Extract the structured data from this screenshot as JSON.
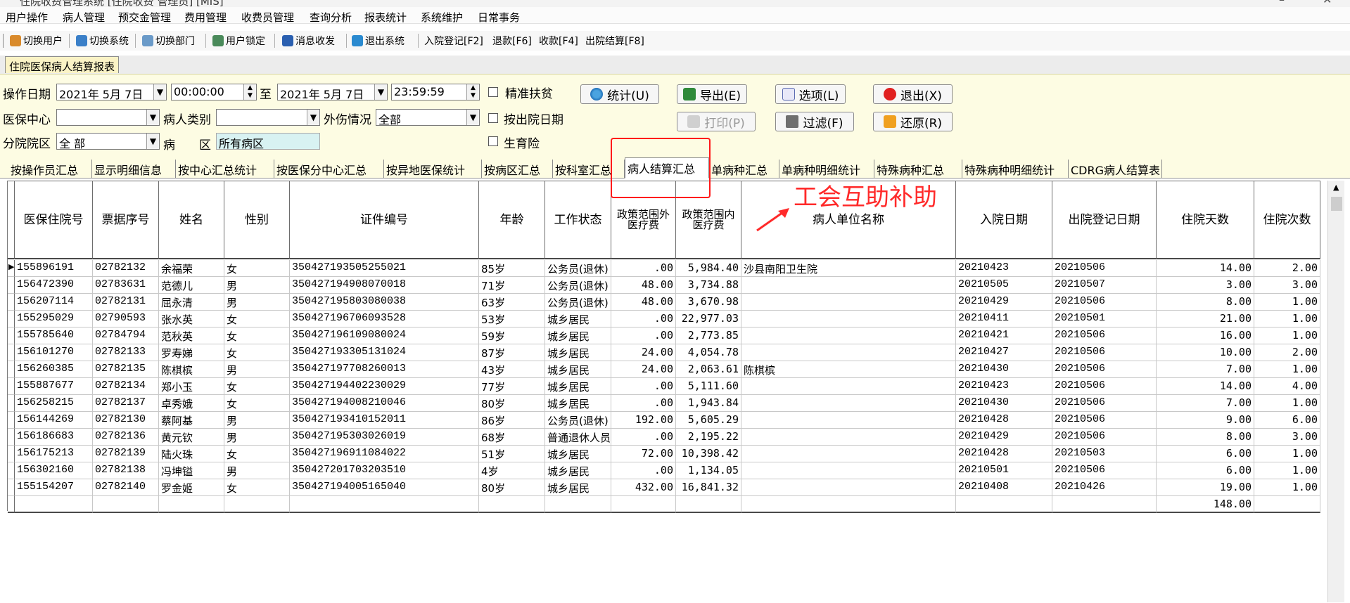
{
  "window": {
    "title": "住院收费管理系统 [住院收费 管理员]  [MIS]"
  },
  "menu": [
    "用户操作",
    "病人管理",
    "预交金管理",
    "费用管理",
    "收费员管理",
    "查询分析",
    "报表统计",
    "系统维护",
    "日常事务"
  ],
  "toolbar": {
    "items": [
      {
        "label": "切换用户",
        "icon": "users-icon"
      },
      {
        "label": "切换系统",
        "icon": "switch-system-icon"
      },
      {
        "label": "切换部门",
        "icon": "department-icon"
      },
      {
        "label": "用户锁定",
        "icon": "user-lock-icon"
      },
      {
        "label": "消息收发",
        "icon": "message-icon"
      },
      {
        "label": "退出系统",
        "icon": "exit-system-icon"
      },
      {
        "label": "入院登记[F2]"
      },
      {
        "label": "退款[F6]"
      },
      {
        "label": "收款[F4]"
      },
      {
        "label": "出院结算[F8]"
      }
    ]
  },
  "doc_tab": "住院医保病人结算报表",
  "filter": {
    "op_date_label": "操作日期",
    "date_from": "2021年 5月 7日",
    "time_from": "00:00:00",
    "to_label": "至",
    "date_to": "2021年 5月 7日",
    "time_to": "23:59:59",
    "center_label": "医保中心",
    "center_value": "",
    "patient_type_label": "病人类别",
    "patient_type_value": "",
    "injury_label": "外伤情况",
    "injury_value": "全部",
    "branch_label": "分院院区",
    "branch_value": "全 部",
    "ward_label": "病　　区",
    "ward_value": "所有病区",
    "checkbox_poverty": "精准扶贫",
    "checkbox_discharge_date": "按出院日期",
    "checkbox_maternity": "生育险",
    "btn_stats": "统计(U)",
    "btn_export": "导出(E)",
    "btn_options": "选项(L)",
    "btn_exit": "退出(X)",
    "btn_print": "打印(P)",
    "btn_filter": "过滤(F)",
    "btn_restore": "还原(R)"
  },
  "sub_tabs": [
    "按操作员汇总",
    "显示明细信息",
    "按中心汇总统计",
    "按医保分中心汇总",
    "按异地医保统计",
    "按病区汇总",
    "按科室汇总",
    "病人结算汇总",
    "单病种汇总",
    "单病种明细统计",
    "特殊病种汇总",
    "特殊病种明细统计",
    "CDRG病人结算表"
  ],
  "active_sub_tab": "病人结算汇总",
  "grid": {
    "headers": [
      "医保住院号",
      "票据序号",
      "姓名",
      "性别",
      "证件编号",
      "年龄",
      "工作状态",
      "政策范围外医疗费",
      "政策范围内医疗费",
      "病人单位名称",
      "入院日期",
      "出院登记日期",
      "住院天数",
      "住院次数"
    ],
    "rows": [
      [
        "155896191",
        "02782132",
        "余福荣",
        "女",
        "350427193505255021",
        "85岁",
        "公务员(退休)",
        ".00",
        "5,984.40",
        "沙县南阳卫生院",
        "20210423",
        "20210506",
        "14.00",
        "2.00"
      ],
      [
        "156472390",
        "02783631",
        "范德儿",
        "男",
        "350427194908070018",
        "71岁",
        "公务员(退休)",
        "48.00",
        "3,734.88",
        "",
        "20210505",
        "20210507",
        "3.00",
        "3.00"
      ],
      [
        "156207114",
        "02782131",
        "屈永清",
        "男",
        "350427195803080038",
        "63岁",
        "公务员(退休)",
        "48.00",
        "3,670.98",
        "",
        "20210429",
        "20210506",
        "8.00",
        "1.00"
      ],
      [
        "155295029",
        "02790593",
        "张水英",
        "女",
        "350427196706093528",
        "53岁",
        "城乡居民",
        ".00",
        "22,977.03",
        "",
        "20210411",
        "20210501",
        "21.00",
        "1.00"
      ],
      [
        "155785640",
        "02784794",
        "范秋英",
        "女",
        "350427196109080024",
        "59岁",
        "城乡居民",
        ".00",
        "2,773.85",
        "",
        "20210421",
        "20210506",
        "16.00",
        "1.00"
      ],
      [
        "156101270",
        "02782133",
        "罗寿娣",
        "女",
        "350427193305131024",
        "87岁",
        "城乡居民",
        "24.00",
        "4,054.78",
        "",
        "20210427",
        "20210506",
        "10.00",
        "2.00"
      ],
      [
        "156260385",
        "02782135",
        "陈棋槟",
        "男",
        "350427197708260013",
        "43岁",
        "城乡居民",
        "24.00",
        "2,063.61",
        "陈棋槟",
        "20210430",
        "20210506",
        "7.00",
        "1.00"
      ],
      [
        "155887677",
        "02782134",
        "郑小玉",
        "女",
        "350427194402230029",
        "77岁",
        "城乡居民",
        ".00",
        "5,111.60",
        "",
        "20210423",
        "20210506",
        "14.00",
        "4.00"
      ],
      [
        "156258215",
        "02782137",
        "卓秀娥",
        "女",
        "350427194008210046",
        "80岁",
        "城乡居民",
        ".00",
        "1,943.84",
        "",
        "20210430",
        "20210506",
        "7.00",
        "1.00"
      ],
      [
        "156144269",
        "02782130",
        "蔡阿基",
        "男",
        "350427193410152011",
        "86岁",
        "公务员(退休)",
        "192.00",
        "5,605.29",
        "",
        "20210428",
        "20210506",
        "9.00",
        "6.00"
      ],
      [
        "156186683",
        "02782136",
        "黄元钦",
        "男",
        "350427195303026019",
        "68岁",
        "普通退休人员",
        ".00",
        "2,195.22",
        "",
        "20210429",
        "20210506",
        "8.00",
        "3.00"
      ],
      [
        "156175213",
        "02782139",
        "陆火珠",
        "女",
        "350427196911084022",
        "51岁",
        "城乡居民",
        "72.00",
        "10,398.42",
        "",
        "20210428",
        "20210503",
        "6.00",
        "1.00"
      ],
      [
        "156302160",
        "02782138",
        "冯坤镒",
        "男",
        "350427201703203510",
        "4岁",
        "城乡居民",
        ".00",
        "1,134.05",
        "",
        "20210501",
        "20210506",
        "6.00",
        "1.00"
      ],
      [
        "155154207",
        "02782140",
        "罗金姬",
        "女",
        "350427194005165040",
        "80岁",
        "城乡居民",
        "432.00",
        "16,841.32",
        "",
        "20210408",
        "20210426",
        "19.00",
        "1.00"
      ]
    ],
    "total_days": "148.00"
  },
  "annotation": {
    "text": "工会互助补助",
    "color": "#ff2a2a"
  }
}
